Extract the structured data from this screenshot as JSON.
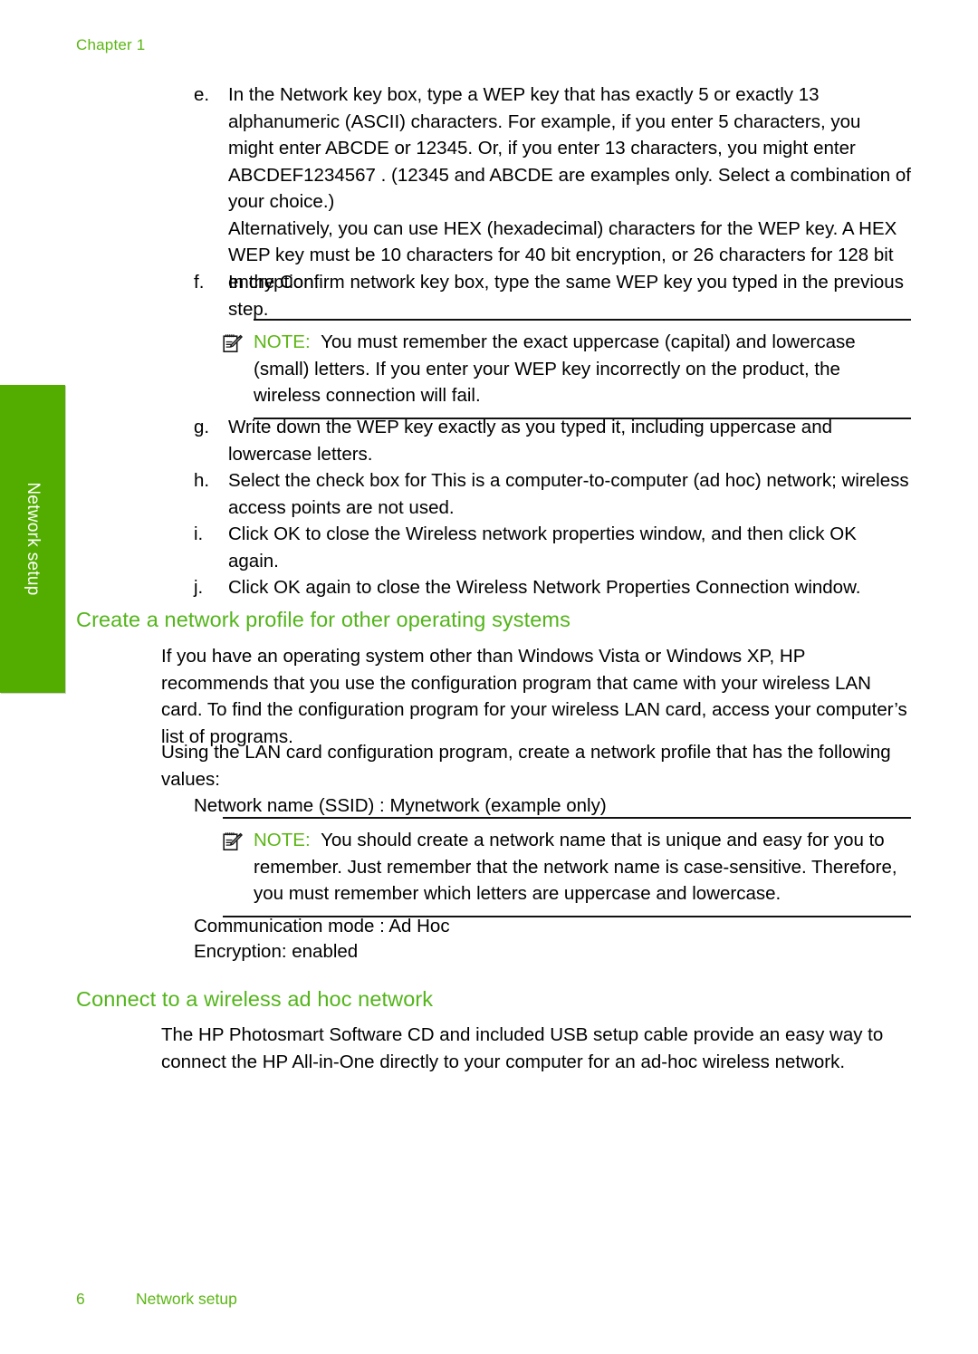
{
  "header": {
    "chapter": "Chapter 1"
  },
  "side_tab": {
    "label": "Network setup"
  },
  "steps": [
    {
      "marker": "e.",
      "text": "In the Network key  box, type a WEP key that has exactly  5 or exactly  13 alphanumeric (ASCII) characters. For example, if you enter 5 characters, you might enter ABCDE or 12345. Or, if you enter 13 characters, you might enter ABCDEF1234567 . (12345 and ABCDE are examples only. Select a combination of your choice.)",
      "continuation": "Alternatively, you can use HEX (hexadecimal) characters for the WEP key. A HEX WEP key must be 10 characters for 40 bit encryption, or 26 characters for 128 bit encryption."
    },
    {
      "marker": "f.",
      "text": "In the Confirm network key   box, type the same WEP key you typed in the previous step."
    },
    {
      "marker": "g.",
      "text": "Write down the WEP key exactly as you typed it, including uppercase and lowercase letters."
    },
    {
      "marker": "h.",
      "text": "Select the check box for This is a computer-to-computer (ad hoc) network; wireless access points are not used."
    },
    {
      "marker": "i.",
      "text": "Click OK to close the Wireless network properties   window, and then click OK again."
    },
    {
      "marker": "j.",
      "text": "Click OK again to close the Wireless Network Properties Connection   window."
    }
  ],
  "notes": [
    {
      "label": "NOTE:",
      "icon": "note-pencil-icon",
      "text": "You must remember the exact uppercase (capital) and lowercase (small) letters. If you enter your WEP key incorrectly on the product, the wireless connection will fail."
    },
    {
      "label": "NOTE:",
      "icon": "note-pencil-icon",
      "text": "You should create a network name that is unique and easy for you to remember. Just remember that the network name is case-sensitive. Therefore, you must remember which letters are uppercase and lowercase."
    }
  ],
  "section_1": {
    "heading": "Create a network profile for other operating systems",
    "paragraph_1": "If you have an operating system other than Windows Vista or Windows XP, HP recommends that you use the configuration program that came with your wireless LAN card. To find the configuration program for your wireless LAN card, access your computer’s list of programs.",
    "paragraph_2": "Using the LAN card configuration program, create a network profile that has the following values:",
    "value_ssid": "Network name (SSID) : Mynetwork (example only)",
    "value_comm_mode": "Communication mode  : Ad Hoc",
    "value_encryption": "Encryption: enabled"
  },
  "section_2": {
    "heading": "Connect to a wireless ad hoc network",
    "paragraph_1": "The HP Photosmart Software CD and included USB setup cable provide an easy way to connect the HP All-in-One directly to your computer for an ad-hoc wireless network."
  },
  "footer": {
    "page_number": "6",
    "section_name": "Network setup"
  },
  "colors": {
    "tab_green": "#52AD00",
    "heading_green": "#53B51A",
    "running_head_green": "#5CB615",
    "text_black": "#0a0a0a"
  }
}
